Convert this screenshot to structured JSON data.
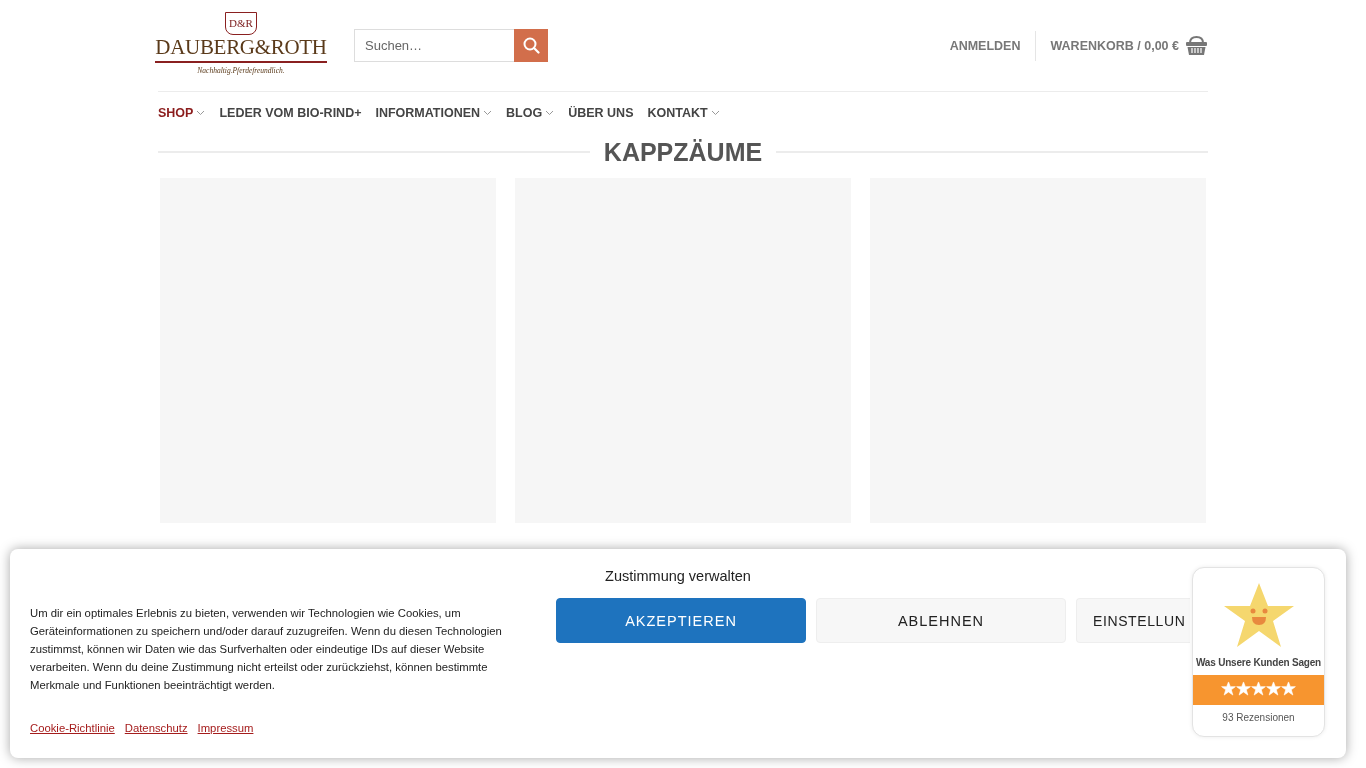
{
  "logo": {
    "monogram": "D&R",
    "name": "DAUBERG&ROTH",
    "tagline": "Nachhaltig.Pferdefreundlich."
  },
  "search": {
    "placeholder": "Suchen…"
  },
  "account": {
    "login": "ANMELDEN",
    "cart": "WARENKORB / 0,00 €"
  },
  "nav": [
    {
      "label": "SHOP",
      "selected": true,
      "dropdown": true
    },
    {
      "label": "LEDER VOM BIO-RIND+",
      "selected": false,
      "dropdown": false
    },
    {
      "label": "INFORMATIONEN",
      "selected": false,
      "dropdown": true
    },
    {
      "label": "BLOG",
      "selected": false,
      "dropdown": true
    },
    {
      "label": "ÜBER UNS",
      "selected": false,
      "dropdown": false
    },
    {
      "label": "KONTAKT",
      "selected": false,
      "dropdown": true
    }
  ],
  "page_title": "KAPPZÄUME",
  "products": [
    {
      "kind": "placeholder"
    },
    {
      "kind": "placeholder"
    },
    {
      "kind": "placeholder"
    }
  ],
  "cookie_banner": {
    "title": "Zustimmung verwalten",
    "text": "Um dir ein optimales Erlebnis zu bieten, verwenden wir Technologien wie Cookies, um Geräteinformationen zu speichern und/oder darauf zuzugreifen. Wenn du diesen Technologien zustimmst, können wir Daten wie das Surfverhalten oder eindeutige IDs auf dieser Website verarbeiten. Wenn du deine Zustimmung nicht erteilst oder zurückziehst, können bestimmte Merkmale und Funktionen beeinträchtigt werden.",
    "buttons": [
      {
        "label": "AKZEPTIEREN",
        "kind": "primary"
      },
      {
        "label": "ABLEHNEN",
        "kind": "secondary"
      },
      {
        "label": "EINSTELLUN",
        "kind": "secondary"
      }
    ],
    "links": [
      "Cookie-Richtlinie",
      "Datenschutz",
      "Impressum"
    ]
  },
  "reviews": {
    "title": "Was Unsere Kunden Sagen",
    "stars": 5,
    "count": "93 Rezensionen"
  }
}
